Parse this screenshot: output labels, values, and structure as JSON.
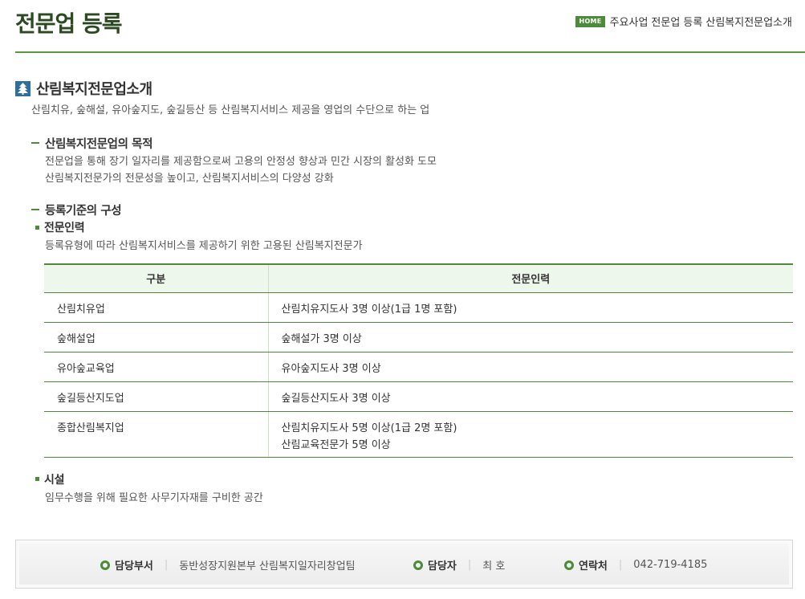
{
  "header": {
    "title": "전문업 등록",
    "home_badge": "HOME",
    "breadcrumb": [
      "주요사업",
      "전문업 등록",
      "산림복지전문업소개"
    ]
  },
  "intro": {
    "title": "산림복지전문업소개",
    "desc": "산림치유, 숲해설, 유아숲지도, 숲길등산 등 산림복지서비스 제공을 영업의 수단으로 하는 업"
  },
  "purpose": {
    "title": "산림복지전문업의 목적",
    "lines": [
      "전문업을 통해 장기 일자리를 제공함으로써 고용의 안정성 향상과 민간 시장의 활성화 도모",
      "산림복지전문가의 전문성을 높이고, 산림복지서비스의 다양성 강화"
    ]
  },
  "criteria": {
    "title": "등록기준의 구성",
    "staff": {
      "title": "전문인력",
      "desc": "등록유형에 따라 산림복지서비스를 제공하기 위한 고용된 산림복지전문가"
    },
    "table": {
      "headers": [
        "구분",
        "전문인력"
      ],
      "rows": [
        {
          "type": "산림치유업",
          "staff": [
            "산림치유지도사 3명 이상(1급 1명 포함)"
          ]
        },
        {
          "type": "숲해설업",
          "staff": [
            "숲해설가 3명 이상"
          ]
        },
        {
          "type": "유아숲교육업",
          "staff": [
            "유아숲지도사 3명 이상"
          ]
        },
        {
          "type": "숲길등산지도업",
          "staff": [
            "숲길등산지도사 3명 이상"
          ]
        },
        {
          "type": "종합산림복지업",
          "staff": [
            "산림치유지도사 5명 이상(1급 2명 포함)",
            "산림교육전문가 5명 이상"
          ]
        }
      ]
    },
    "facility": {
      "title": "시설",
      "desc": "임무수행을 위해 필요한 사무기자재를 구비한 공간"
    }
  },
  "footer": {
    "dept_label": "담당부서",
    "dept_value": "동반성장지원본부 산림복지일자리창업팀",
    "person_label": "담당자",
    "person_value": "최 호",
    "contact_label": "연락처",
    "contact_value": "042-719-4185"
  },
  "colors": {
    "accent_green": "#4d8a3a",
    "title_green": "#2b4a22",
    "header_bg": "#eef7ec",
    "icon_blue": "#2f6f9f"
  }
}
